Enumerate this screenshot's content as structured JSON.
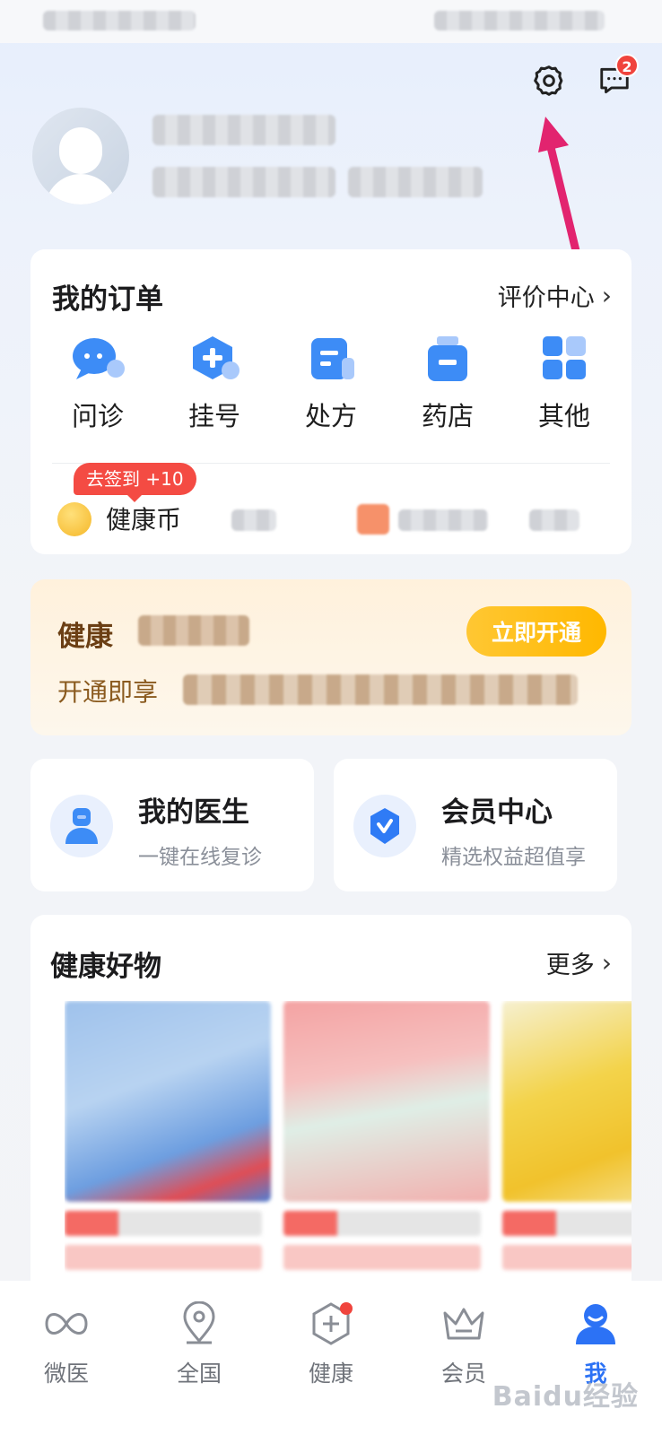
{
  "header": {
    "message_badge_count": "2"
  },
  "orders": {
    "title": "我的订单",
    "review_link": "评价中心",
    "items": [
      {
        "label": "问诊",
        "icon": "chat-bubble-icon"
      },
      {
        "label": "挂号",
        "icon": "hexagon-plus-icon"
      },
      {
        "label": "处方",
        "icon": "prescription-icon"
      },
      {
        "label": "药店",
        "icon": "medicine-bottle-icon"
      },
      {
        "label": "其他",
        "icon": "grid-icon"
      }
    ],
    "checkin_tip": "去签到 +10",
    "coin_label": "健康币"
  },
  "membership_banner": {
    "title": "健康",
    "subtitle": "开通即享",
    "button": "立即开通"
  },
  "quick_cards": {
    "doctor": {
      "title": "我的医生",
      "subtitle": "一键在线复诊"
    },
    "member": {
      "title": "会员中心",
      "subtitle": "精选权益超值享"
    }
  },
  "goods": {
    "title": "健康好物",
    "more_link": "更多"
  },
  "tabbar": {
    "items": [
      {
        "label": "微医",
        "icon": "weiyi-logo-icon",
        "active": false
      },
      {
        "label": "全国",
        "icon": "location-pin-icon",
        "active": false
      },
      {
        "label": "健康",
        "icon": "health-hexagon-icon",
        "active": false
      },
      {
        "label": "会员",
        "icon": "crown-icon",
        "active": false
      },
      {
        "label": "我",
        "icon": "user-icon",
        "active": true
      }
    ]
  },
  "watermark": "Baidu经验",
  "colors": {
    "accent_blue": "#2c72f5",
    "badge_red": "#f0443d",
    "annotation_arrow": "#e2246f",
    "vip_gold": "#ffb800"
  }
}
